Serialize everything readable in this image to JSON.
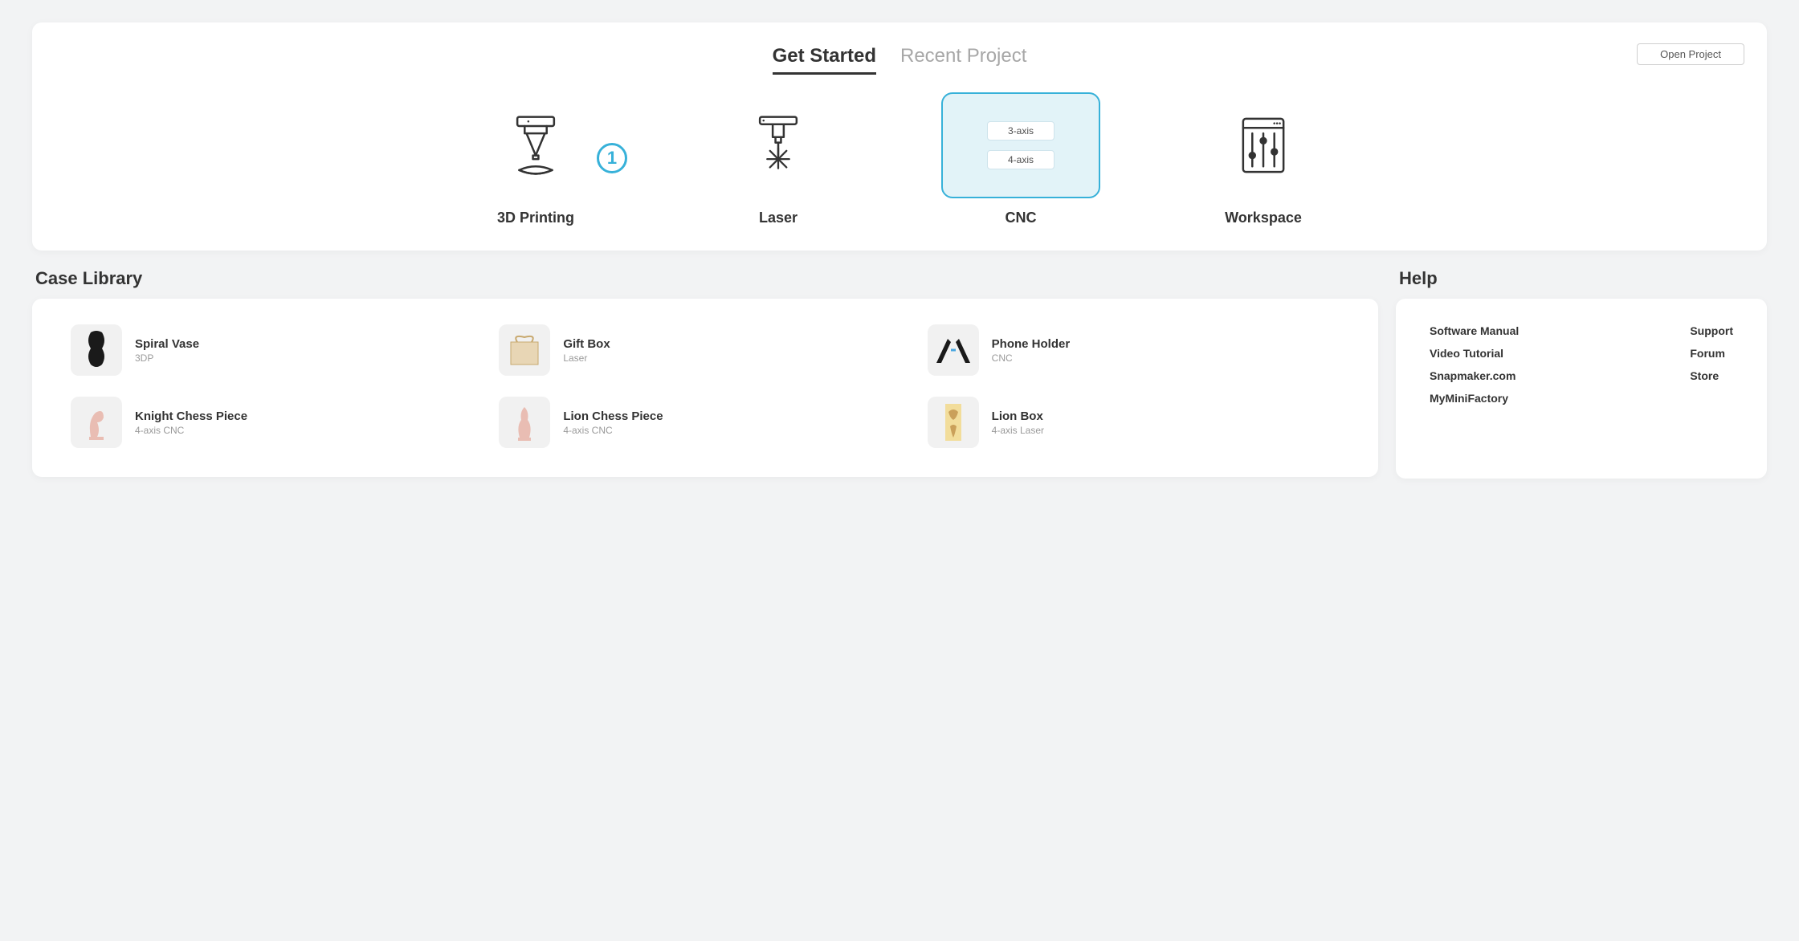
{
  "tabs": {
    "get_started": "Get Started",
    "recent_project": "Recent Project"
  },
  "open_project_label": "Open Project",
  "tiles": {
    "printing": "3D Printing",
    "laser": "Laser",
    "cnc": "CNC",
    "workspace": "Workspace",
    "cnc_options": {
      "three": "3-axis",
      "four": "4-axis"
    }
  },
  "annotation": "1",
  "sections": {
    "case_library": "Case Library",
    "help": "Help"
  },
  "cases": {
    "spiral_vase": {
      "name": "Spiral Vase",
      "type": "3DP"
    },
    "gift_box": {
      "name": "Gift Box",
      "type": "Laser"
    },
    "phone_holder": {
      "name": "Phone Holder",
      "type": "CNC"
    },
    "knight": {
      "name": "Knight Chess Piece",
      "type": "4-axis CNC"
    },
    "lion_piece": {
      "name": "Lion Chess Piece",
      "type": "4-axis CNC"
    },
    "lion_box": {
      "name": "Lion Box",
      "type": "4-axis Laser"
    }
  },
  "help": {
    "left": {
      "software_manual": "Software Manual",
      "video_tutorial": "Video Tutorial",
      "snapmaker": "Snapmaker.com",
      "myminifactory": "MyMiniFactory"
    },
    "right": {
      "support": "Support",
      "forum": "Forum",
      "store": "Store"
    }
  }
}
